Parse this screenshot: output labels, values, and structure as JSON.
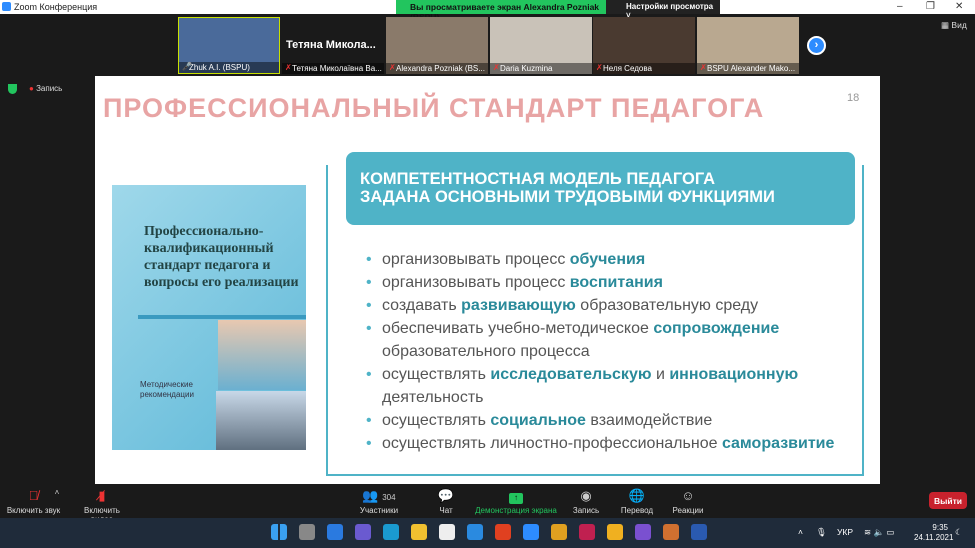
{
  "window": {
    "title": "Zoom Конференция",
    "share_banner": "Вы просматриваете экран Alexandra Pozniak (BSPU)",
    "view_settings": "Настройки просмотра",
    "view_button": "Вид"
  },
  "status": {
    "record_label": "Запись"
  },
  "participants": [
    {
      "name": "Zhuk A.I. (BSPU)",
      "color": "#4a6a9a"
    },
    {
      "name": "Тетяна Миколаївна Ва...",
      "big_name": "Тетяна Микола...",
      "color": "#1a1a1a"
    },
    {
      "name": "Alexandra Pozniak (BS...",
      "color": "#8a7a6a"
    },
    {
      "name": "Daria Kuzmina",
      "color": "#c9c2b8"
    },
    {
      "name": "Неля Седова",
      "color": "#4a3a30"
    },
    {
      "name": "BSPU Alexander Mako...",
      "color": "#b9a890"
    }
  ],
  "slide": {
    "title": "ПРОФЕССИОНАЛЬНЫЙ СТАНДАРТ ПЕДАГОГА",
    "page_number": "18",
    "book_title": "Профессионально-квалификационный стандарт педагога и вопросы его реализации",
    "book_subtitle": "Методические рекомендации",
    "header_line1": "КОМПЕТЕНТНОСТНАЯ МОДЕЛЬ ПЕДАГОГА",
    "header_line2": "ЗАДАНА ОСНОВНЫМИ ТРУДОВЫМИ ФУНКЦИЯМИ",
    "bullets": [
      {
        "pre": "организовывать процесс ",
        "bold": "обучения",
        "post": ""
      },
      {
        "pre": "организовывать процесс ",
        "bold": "воспитания",
        "post": ""
      },
      {
        "pre": "создавать ",
        "bold": "развивающую",
        "post": " образовательную среду"
      },
      {
        "pre": "обеспечивать учебно-методическое  ",
        "bold": "сопровождение",
        "post": " образовательного процесса"
      },
      {
        "pre": "осуществлять ",
        "bold": "исследовательскую",
        "post": " и ",
        "bold2": "инновационную",
        "post2": " деятельность"
      },
      {
        "pre": "осуществлять ",
        "bold": "социальное",
        "post": " взаимодействие"
      },
      {
        "pre": "осуществлять личностно-профессиональное ",
        "bold": "саморазвитие",
        "post": ""
      }
    ],
    "accent": "#4fb3c7",
    "title_color": "#e8a4a4"
  },
  "toolbar": {
    "unmute": "Включить звук",
    "start_video": "Включить видео",
    "participants": "Участники",
    "participants_count": "304",
    "chat": "Чат",
    "share_screen": "Демонстрация экрана",
    "record": "Запись",
    "translate": "Перевод",
    "reactions": "Реакции",
    "leave": "Выйти"
  },
  "taskbar": {
    "language": "УКР",
    "time": "9:35",
    "date": "24.11.2021"
  }
}
